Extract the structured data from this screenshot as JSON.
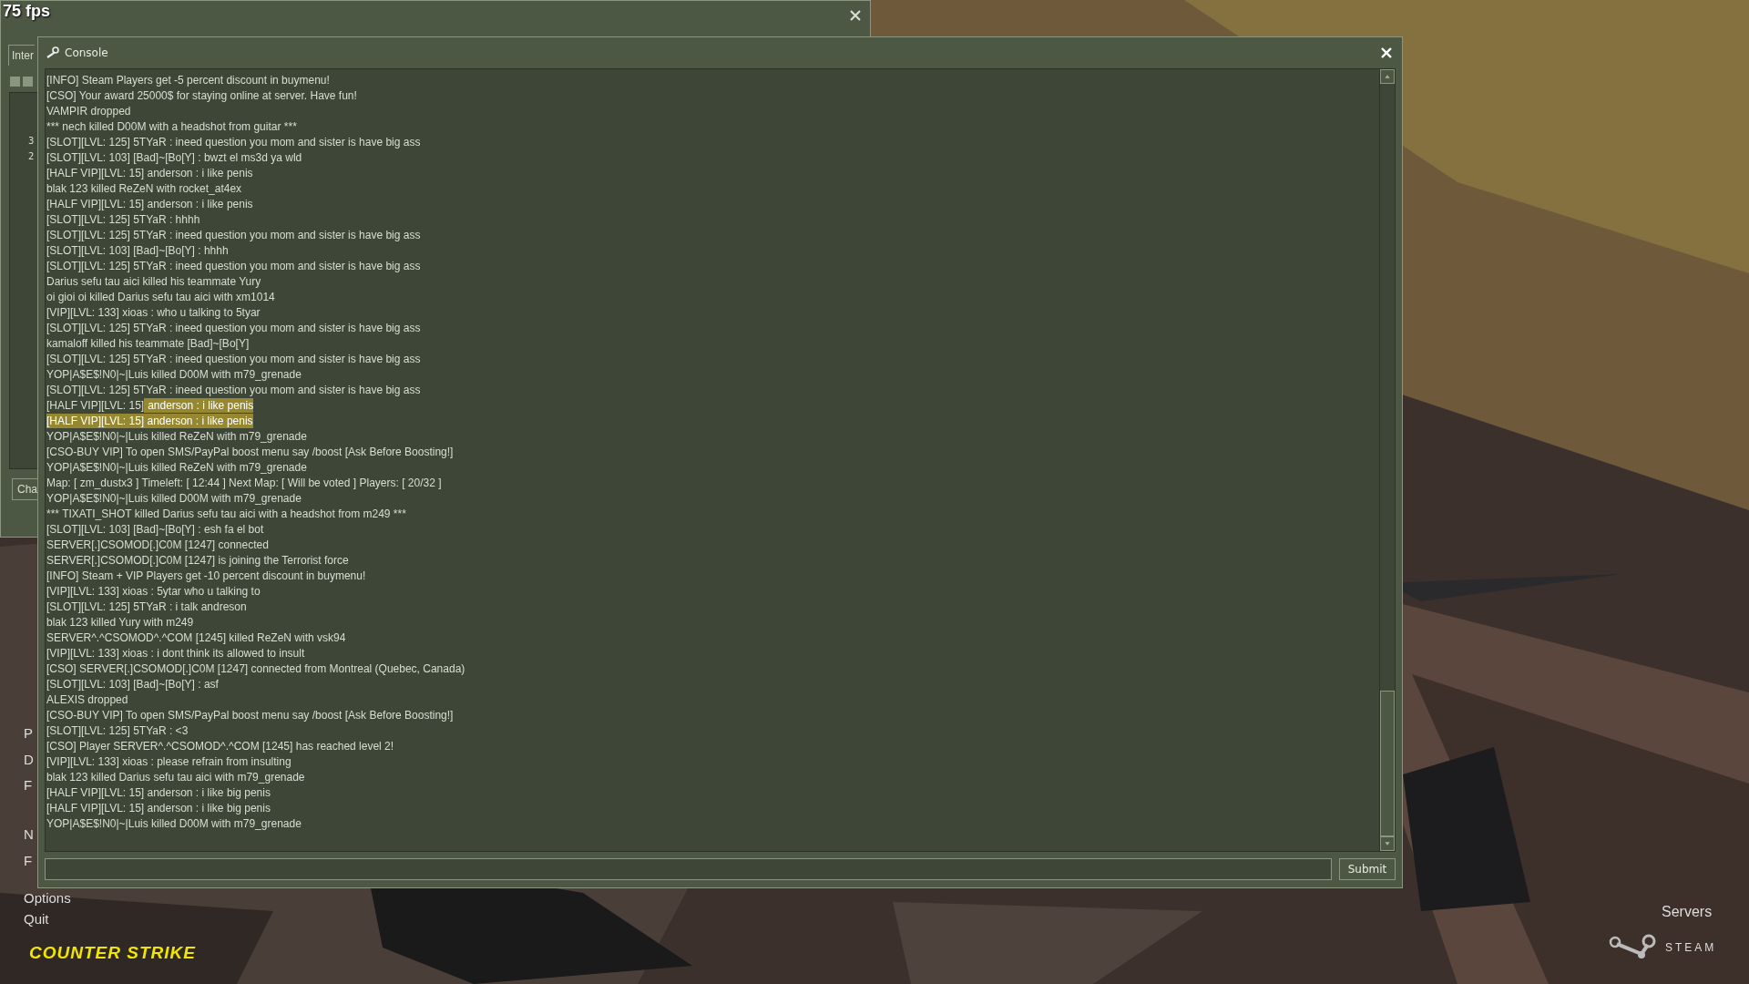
{
  "fps": "75 fps",
  "back_window": {
    "tab": "Inter",
    "numbers": [
      "3",
      "2"
    ],
    "button": "Cha"
  },
  "main_menu": {
    "items": [
      "P",
      "D",
      "F",
      "N",
      "F",
      "Options",
      "Quit"
    ],
    "logo": "COUNTER STRIKE"
  },
  "corner": {
    "servers": "Servers",
    "steam": "STEAM"
  },
  "console": {
    "title": "Console",
    "lines": [
      {
        "text": "[INFO] Steam Players get -5 percent discount in buymenu!",
        "selected": false
      },
      {
        "text": "[CSO] Your award 25000$ for staying online at server. Have fun!",
        "selected": false
      },
      {
        "text": "VAMPIR dropped",
        "selected": false
      },
      {
        "text": "*** nech killed D00M with a headshot from guitar ***",
        "selected": false
      },
      {
        "text": "[SLOT][LVL: 125] 5TYaR : ineed question you mom and sister is have big ass",
        "selected": false
      },
      {
        "text": "[SLOT][LVL: 103] [Bad]~[Bo[Y] : bwzt el ms3d ya wld",
        "selected": false
      },
      {
        "text": "[HALF VIP][LVL: 15] anderson : i like penis",
        "selected": false
      },
      {
        "text": "blak 123 killed ReZeN with rocket_at4ex",
        "selected": false
      },
      {
        "text": "[HALF VIP][LVL: 15] anderson : i like penis",
        "selected": false
      },
      {
        "text": "[SLOT][LVL: 125] 5TYaR : hhhh",
        "selected": false
      },
      {
        "text": "[SLOT][LVL: 125] 5TYaR : ineed question you mom and sister is have big ass",
        "selected": false
      },
      {
        "text": "[SLOT][LVL: 103] [Bad]~[Bo[Y] : hhhh",
        "selected": false
      },
      {
        "text": "[SLOT][LVL: 125] 5TYaR : ineed question you mom and sister is have big ass",
        "selected": false
      },
      {
        "text": "Darius sefu tau aici killed his teammate Yury",
        "selected": false
      },
      {
        "text": "oi gioi oi killed Darius sefu tau aici with xm1014",
        "selected": false
      },
      {
        "text": "[VIP][LVL: 133] xioas : who u talking to 5tyar",
        "selected": false
      },
      {
        "text": "[SLOT][LVL: 125] 5TYaR : ineed question you mom and sister is have big ass",
        "selected": false
      },
      {
        "text": "kamaloff killed his teammate [Bad]~[Bo[Y]",
        "selected": false
      },
      {
        "text": "[SLOT][LVL: 125] 5TYaR : ineed question you mom and sister is have big ass",
        "selected": false
      },
      {
        "text": "YOP|A$E$!N0|~|Luis killed D00M with m79_grenade",
        "selected": false
      },
      {
        "text": "[SLOT][LVL: 125] 5TYaR : ineed question you mom and sister is have big ass",
        "selected": false
      },
      {
        "lead": "[HALF VIP][LVL: 15]",
        "text": "anderson : i like penis",
        "selected": true
      },
      {
        "text": "[HALF VIP][LVL: 15] anderson : i like penis",
        "selected": true
      },
      {
        "text": "YOP|A$E$!N0|~|Luis killed ReZeN with m79_grenade",
        "selected": false
      },
      {
        "text": "[CSO-BUY VIP] To open SMS/PayPal boost menu say /boost [Ask Before Boosting!]",
        "selected": false
      },
      {
        "text": "YOP|A$E$!N0|~|Luis killed ReZeN with m79_grenade",
        "selected": false
      },
      {
        "text": "Map: [ zm_dustx3 ] Timeleft: [ 12:44 ] Next Map: [ Will be voted ] Players: [ 20/32 ]",
        "selected": false
      },
      {
        "text": "YOP|A$E$!N0|~|Luis killed D00M with m79_grenade",
        "selected": false
      },
      {
        "text": "*** TIXATI_SHOT killed Darius sefu tau aici with a headshot from m249 ***",
        "selected": false
      },
      {
        "text": "[SLOT][LVL: 103] [Bad]~[Bo[Y] : esh fa el bot",
        "selected": false
      },
      {
        "text": "SERVER[.]CSOMOD[.]C0M [1247] connected",
        "selected": false
      },
      {
        "text": "SERVER[.]CSOMOD[.]C0M [1247] is joining the Terrorist force",
        "selected": false
      },
      {
        "text": "[INFO] Steam + VIP Players get -10 percent discount in buymenu!",
        "selected": false
      },
      {
        "text": "[VIP][LVL: 133] xioas : 5ytar who u talking to",
        "selected": false
      },
      {
        "text": "[SLOT][LVL: 125] 5TYaR : i talk andreson",
        "selected": false
      },
      {
        "text": "blak 123 killed Yury with m249",
        "selected": false
      },
      {
        "text": "SERVER^.^CSOMOD^.^COM [1245] killed ReZeN with vsk94",
        "selected": false
      },
      {
        "text": "[VIP][LVL: 133] xioas : i dont think its allowed to insult",
        "selected": false
      },
      {
        "text": "[CSO] SERVER[.]CSOMOD[.]C0M [1247] connected from Montreal (Quebec, Canada)",
        "selected": false
      },
      {
        "text": "[SLOT][LVL: 103] [Bad]~[Bo[Y] : asf",
        "selected": false
      },
      {
        "text": "ALEXIS dropped",
        "selected": false
      },
      {
        "text": "[CSO-BUY VIP] To open SMS/PayPal boost menu say /boost [Ask Before Boosting!]",
        "selected": false
      },
      {
        "text": "[SLOT][LVL: 125] 5TYaR : <3",
        "selected": false
      },
      {
        "text": "[CSO] Player SERVER^.^CSOMOD^.^COM [1245] has reached level 2!",
        "selected": false
      },
      {
        "text": "[VIP][LVL: 133] xioas : please refrain from insulting",
        "selected": false
      },
      {
        "text": "blak 123 killed Darius sefu tau aici with m79_grenade",
        "selected": false
      },
      {
        "text": "[HALF VIP][LVL: 15] anderson : i like big penis",
        "selected": false
      },
      {
        "text": "[HALF VIP][LVL: 15] anderson : i like big penis",
        "selected": false
      },
      {
        "text": "YOP|A$E$!N0|~|Luis killed D00M with m79_grenade",
        "selected": false
      }
    ],
    "submit": "Submit"
  }
}
